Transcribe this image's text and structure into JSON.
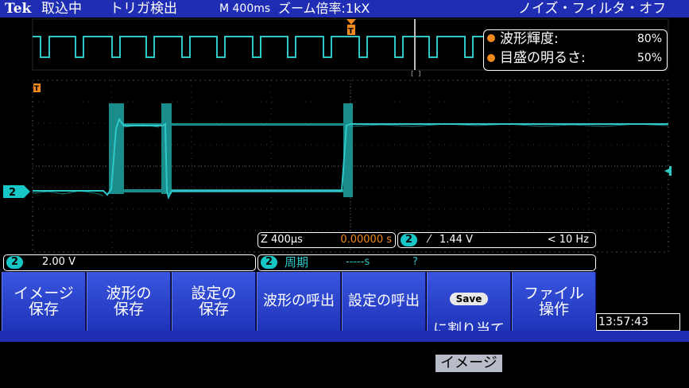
{
  "top_bar": {
    "brand": "Tek",
    "acq_state": "取込中",
    "trigger_state": "トリガ検出",
    "timebase": "M 400ms",
    "zoom_label": "ズーム倍率:1kX",
    "noise_filter": "ノイズ・フィルタ・オフ"
  },
  "intensity_readout": {
    "wave_label": "波形輝度:",
    "wave_value": "80%",
    "grid_label": "目盛の明るさ:",
    "grid_value": "50%"
  },
  "channel_marker": "2",
  "trigger_marker": "T",
  "status": {
    "zoom_scale": "Z 400μs",
    "zoom_position": "0.00000 s",
    "trig_channel": "2",
    "trig_level": "1.44 V",
    "trig_freq": "< 10 Hz",
    "ch_scale_channel": "2",
    "ch_scale": "2.00 V",
    "measure_channel": "2",
    "measure_name": "周期",
    "measure_value": "-----s",
    "measure_flag": "?"
  },
  "menu": {
    "items": [
      {
        "label": "イメージ\n保存"
      },
      {
        "label": "波形の\n保存"
      },
      {
        "label": "設定の\n保存"
      },
      {
        "label": "波形の呼出"
      },
      {
        "label": "設定の呼出"
      },
      {
        "label": "に割り当て"
      },
      {
        "label": "ファイル\n操作"
      }
    ],
    "save_badge": "Save",
    "assign_value": "イメージ"
  },
  "clock": "13:57:43",
  "colors": {
    "trace": "#2ec8c8",
    "accent_orange": "#f08a1c",
    "menu_blue": "#2a43d0",
    "channel_cyan": "#17c7c7"
  }
}
